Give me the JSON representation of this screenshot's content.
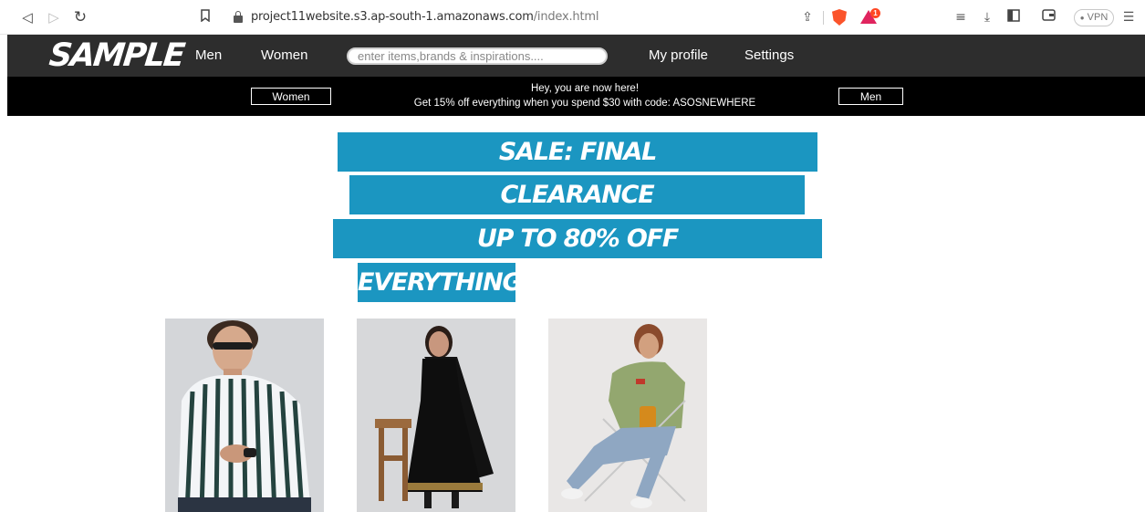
{
  "browser": {
    "url_domain": "project11website.s3.ap-south-1.amazonaws.com",
    "url_path": "/index.html",
    "rewards_count": "1",
    "vpn_label": "VPN"
  },
  "header": {
    "logo": "SAMPLE",
    "nav_men": "Men",
    "nav_women": "Women",
    "search_placeholder": "enter items,brands & inspirations....",
    "my_profile": "My profile",
    "settings": "Settings",
    "background": "#2d2d2d"
  },
  "promo": {
    "women_button": "Women",
    "men_button": "Men",
    "line1": "Hey, you are now here!",
    "line2": "Get 15% off everything when you spend $30 with code: ASOSNEWHERE",
    "background": "#000000"
  },
  "banners": {
    "color": "#1b96c1",
    "line1": "SALE: FINAL",
    "line2": "CLEARANCE",
    "line3": "UP TO 80% OFF",
    "line4": "EVERYTHING"
  },
  "products": [
    {
      "image": "man-striped-shirt"
    },
    {
      "image": "woman-black-dress"
    },
    {
      "image": "man-green-sweatshirt-chair"
    }
  ]
}
